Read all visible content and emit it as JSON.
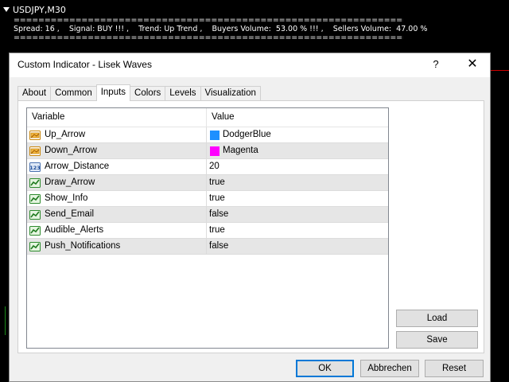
{
  "chart": {
    "symbol": "USDJPY,M30",
    "separator": "======================================================================================",
    "info": "Spread: 16 ,    Signal: BUY !!! ,    Trend: Up Trend ,    Buyers Volume:  53.00 % !!! ,    Sellers Volume:  47.00 %"
  },
  "dialog": {
    "title": "Custom Indicator - Lisek Waves",
    "help": "?",
    "close": "✕"
  },
  "tabs": [
    {
      "label": "About"
    },
    {
      "label": "Common"
    },
    {
      "label": "Inputs"
    },
    {
      "label": "Colors"
    },
    {
      "label": "Levels"
    },
    {
      "label": "Visualization"
    }
  ],
  "active_tab": "Inputs",
  "grid": {
    "col_variable": "Variable",
    "col_value": "Value",
    "rows": [
      {
        "name": "Up_Arrow",
        "value": "DodgerBlue",
        "icon": "color-input-icon",
        "swatch": "#1e90ff"
      },
      {
        "name": "Down_Arrow",
        "value": "Magenta",
        "icon": "color-input-icon",
        "swatch": "#ff00ff"
      },
      {
        "name": "Arrow_Distance",
        "value": "20",
        "icon": "integer-input-icon"
      },
      {
        "name": "Draw_Arrow",
        "value": "true",
        "icon": "bool-input-icon"
      },
      {
        "name": "Show_Info",
        "value": "true",
        "icon": "bool-input-icon"
      },
      {
        "name": "Send_Email",
        "value": "false",
        "icon": "bool-input-icon"
      },
      {
        "name": "Audible_Alerts",
        "value": "true",
        "icon": "bool-input-icon"
      },
      {
        "name": "Push_Notifications",
        "value": "false",
        "icon": "bool-input-icon"
      }
    ]
  },
  "buttons": {
    "load": "Load",
    "save": "Save",
    "ok": "OK",
    "cancel": "Abbrechen",
    "reset": "Reset"
  }
}
